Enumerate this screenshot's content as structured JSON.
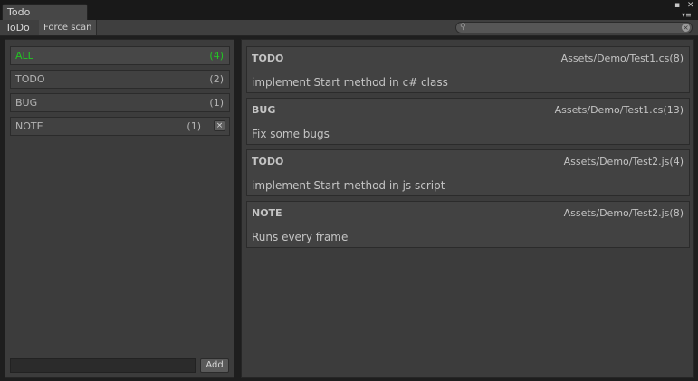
{
  "window": {
    "tab_title": "Todo",
    "controls": [
      "maximize-icon",
      "close-icon",
      "menu-icon"
    ],
    "close_glyph": "✕",
    "maximize_glyph": "▪",
    "menu_glyph": "▾≡"
  },
  "toolbar": {
    "title": "ToDo",
    "force_scan_label": "Force scan",
    "search": {
      "value": "",
      "placeholder": "",
      "icon_glyph": "⚲",
      "clear_glyph": "×"
    }
  },
  "categories": [
    {
      "name": "ALL",
      "count": "(4)",
      "active": true
    },
    {
      "name": "TODO",
      "count": "(2)",
      "active": false
    },
    {
      "name": "BUG",
      "count": "(1)",
      "active": false
    },
    {
      "name": "NOTE",
      "count": "(1)",
      "active": false,
      "delete_glyph": "×"
    }
  ],
  "add_tag": {
    "value": "",
    "placeholder": "",
    "button_label": "Add"
  },
  "entries": [
    {
      "type": "TODO",
      "path": "Assets/Demo/Test1.cs(8)",
      "text": "implement Start method in c# class"
    },
    {
      "type": "BUG",
      "path": "Assets/Demo/Test1.cs(13)",
      "text": "Fix some bugs"
    },
    {
      "type": "TODO",
      "path": "Assets/Demo/Test2.js(4)",
      "text": "implement Start method in js script"
    },
    {
      "type": "NOTE",
      "path": "Assets/Demo/Test2.js(8)",
      "text": "Runs every frame"
    }
  ],
  "colors": {
    "active_category": "#23c423",
    "background": "#3c3c3c",
    "text": "#c4c4c4"
  }
}
